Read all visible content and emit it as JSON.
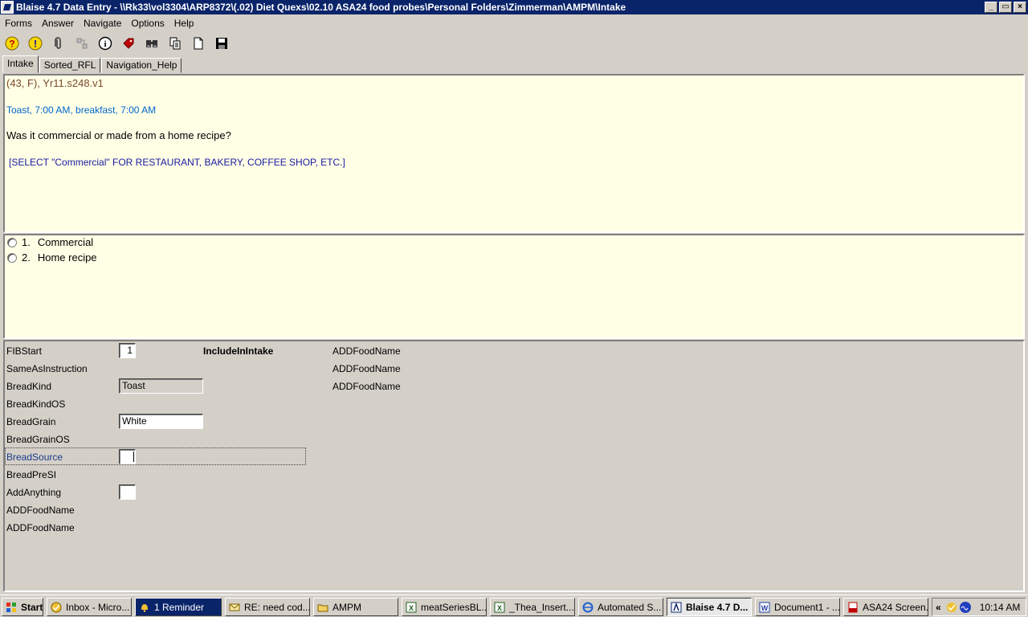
{
  "window": {
    "title": "Blaise 4.7 Data Entry - \\\\Rk33\\vol3304\\ARP8372\\(.02) Diet Quexs\\02.10 ASA24 food probes\\Personal Folders\\Zimmerman\\AMPM\\Intake",
    "min_glyph": "_",
    "max_glyph": "▭",
    "close_glyph": "×"
  },
  "menu": [
    "Forms",
    "Answer",
    "Navigate",
    "Options",
    "Help"
  ],
  "toolbar": {
    "icons": [
      "help-icon",
      "info-alert-icon",
      "paperclip-icon",
      "network-icon",
      "about-icon",
      "tag-icon",
      "binoculars-icon",
      "copy-doc-icon",
      "new-doc-icon",
      "save-icon"
    ]
  },
  "tabs": [
    "Intake",
    "Sorted_RFL",
    "Navigation_Help"
  ],
  "question": {
    "meta": "(43, F),   Yr11.s248.v1",
    "context": "Toast, 7:00 AM, breakfast, 7:00 AM",
    "text": "Was it commercial or made from a home recipe?",
    "instruction": "[SELECT \"Commercial\" FOR RESTAURANT, BAKERY, COFFEE SHOP, ETC.]"
  },
  "answers": [
    {
      "number": "1.",
      "label": "Commercial"
    },
    {
      "number": "2.",
      "label": "Home recipe"
    }
  ],
  "form": {
    "fields": [
      {
        "label": "FIBStart",
        "value": "1"
      },
      {
        "label": "SameAsInstruction",
        "value": ""
      },
      {
        "label": "BreadKind",
        "value": "Toast"
      },
      {
        "label": "BreadKindOS",
        "value": ""
      },
      {
        "label": "BreadGrain",
        "value": "White"
      },
      {
        "label": "BreadGrainOS",
        "value": ""
      },
      {
        "label": "BreadSource",
        "value": ""
      },
      {
        "label": "BreadPreSI",
        "value": ""
      },
      {
        "label": "AddAnything",
        "value": ""
      },
      {
        "label": "ADDFoodName",
        "value": ""
      },
      {
        "label": "ADDFoodName",
        "value": ""
      }
    ],
    "block_label": "IncludeInIntake",
    "right_labels": [
      "ADDFoodName",
      "ADDFoodName",
      "ADDFoodName"
    ]
  },
  "taskbar": {
    "start": "Start",
    "items": [
      {
        "label": "Inbox - Micro...",
        "icon": "outlook-icon"
      },
      {
        "label": "1 Reminder",
        "icon": "bell-icon"
      },
      {
        "label": "RE: need cod...",
        "icon": "email-icon"
      },
      {
        "label": "AMPM",
        "icon": "folder-icon"
      },
      {
        "label": "meatSeriesBL...",
        "icon": "excel-icon"
      },
      {
        "label": "_Thea_Insert...",
        "icon": "excel-icon"
      },
      {
        "label": "Automated S...",
        "icon": "ie-icon"
      },
      {
        "label": "Blaise 4.7 D...",
        "icon": "blaise-icon"
      },
      {
        "label": "Document1 - ...",
        "icon": "word-icon"
      },
      {
        "label": "ASA24 Screen...",
        "icon": "pdf-icon"
      }
    ],
    "tray_arrows": "«",
    "clock": "10:14 AM"
  },
  "colors": {
    "titlebar": "#0a246a",
    "panel_bg": "#ffffe6",
    "meta_text": "#7a4a2a",
    "context_text": "#0066cc",
    "instruction_text": "#1a1aa0",
    "focus_label": "#1a3a8a",
    "reminder_bg": "#0a246a"
  }
}
